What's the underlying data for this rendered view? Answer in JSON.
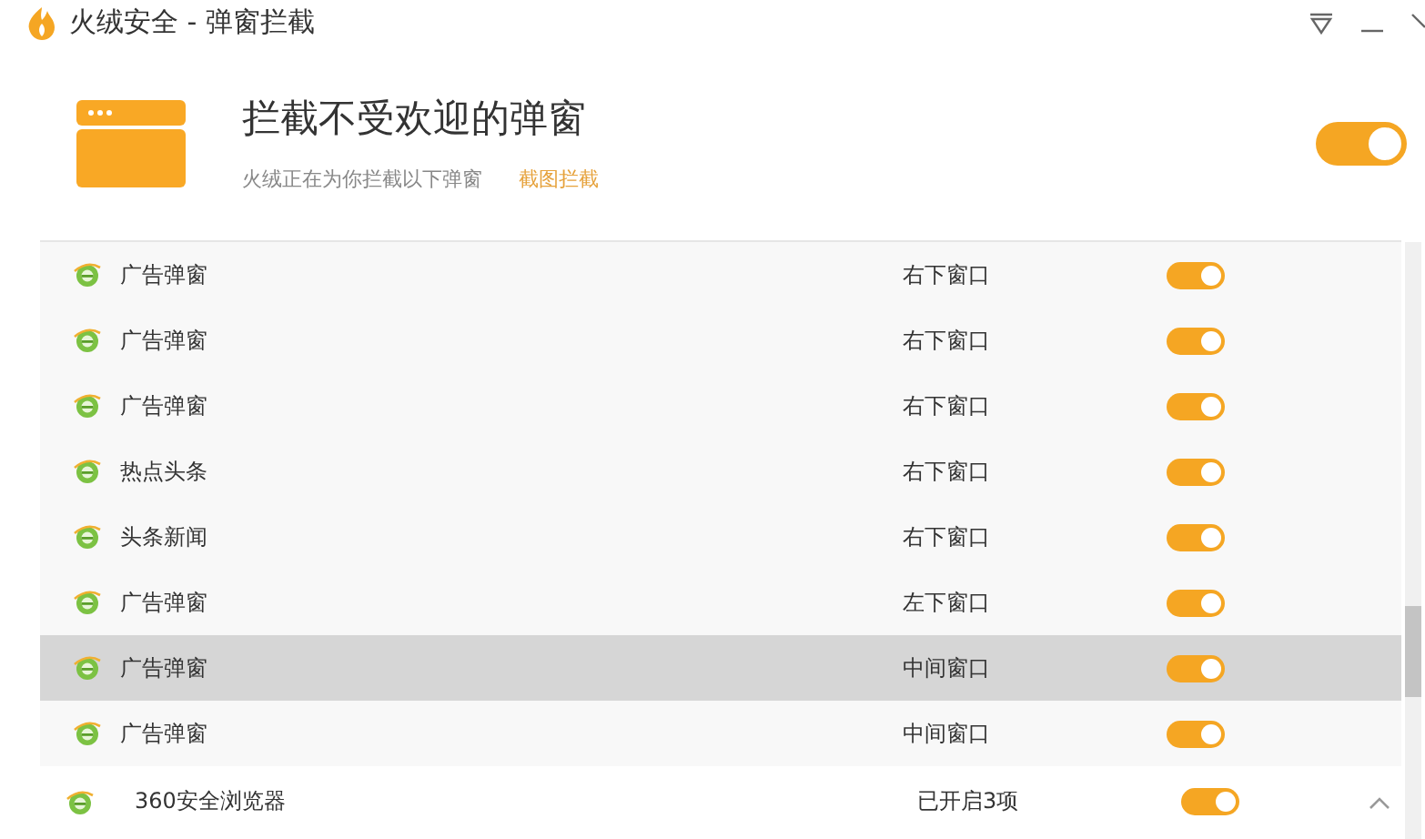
{
  "window": {
    "title": "火绒安全 - 弹窗拦截"
  },
  "header": {
    "title": "拦截不受欢迎的弹窗",
    "subtitle": "火绒正在为你拦截以下弹窗",
    "link": "截图拦截",
    "on": true
  },
  "items": [
    {
      "name": "广告弹窗",
      "position": "右下窗口",
      "on": true,
      "selected": false
    },
    {
      "name": "广告弹窗",
      "position": "右下窗口",
      "on": true,
      "selected": false
    },
    {
      "name": "广告弹窗",
      "position": "右下窗口",
      "on": true,
      "selected": false
    },
    {
      "name": "热点头条",
      "position": "右下窗口",
      "on": true,
      "selected": false
    },
    {
      "name": "头条新闻",
      "position": "右下窗口",
      "on": true,
      "selected": false
    },
    {
      "name": "广告弹窗",
      "position": "左下窗口",
      "on": true,
      "selected": false
    },
    {
      "name": "广告弹窗",
      "position": "中间窗口",
      "on": true,
      "selected": true
    },
    {
      "name": "广告弹窗",
      "position": "中间窗口",
      "on": true,
      "selected": false
    }
  ],
  "group": {
    "name": "360安全浏览器",
    "status": "已开启3项",
    "on": true,
    "expanded": true
  }
}
